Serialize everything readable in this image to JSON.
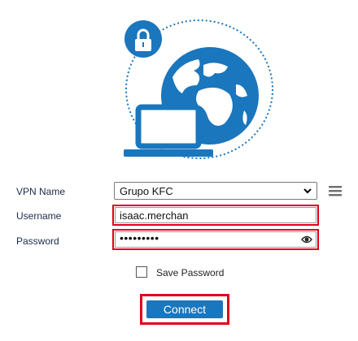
{
  "form": {
    "vpn_name_label": "VPN Name",
    "vpn_name_value": "Grupo KFC",
    "username_label": "Username",
    "username_value": "isaac.merchan",
    "password_label": "Password",
    "password_masked": "•••••••••",
    "save_password_label": "Save Password",
    "save_password_checked": false,
    "connect_label": "Connect"
  },
  "icons": {
    "hero": "laptop-globe-lock-illustration",
    "select": "chevron-down-icon",
    "menu": "hamburger-menu-icon",
    "password_visibility": "eye-icon"
  },
  "colors": {
    "brand_blue": "#1a76bd",
    "highlight_red": "#e0001b",
    "label_navy": "#1c2b4a"
  }
}
